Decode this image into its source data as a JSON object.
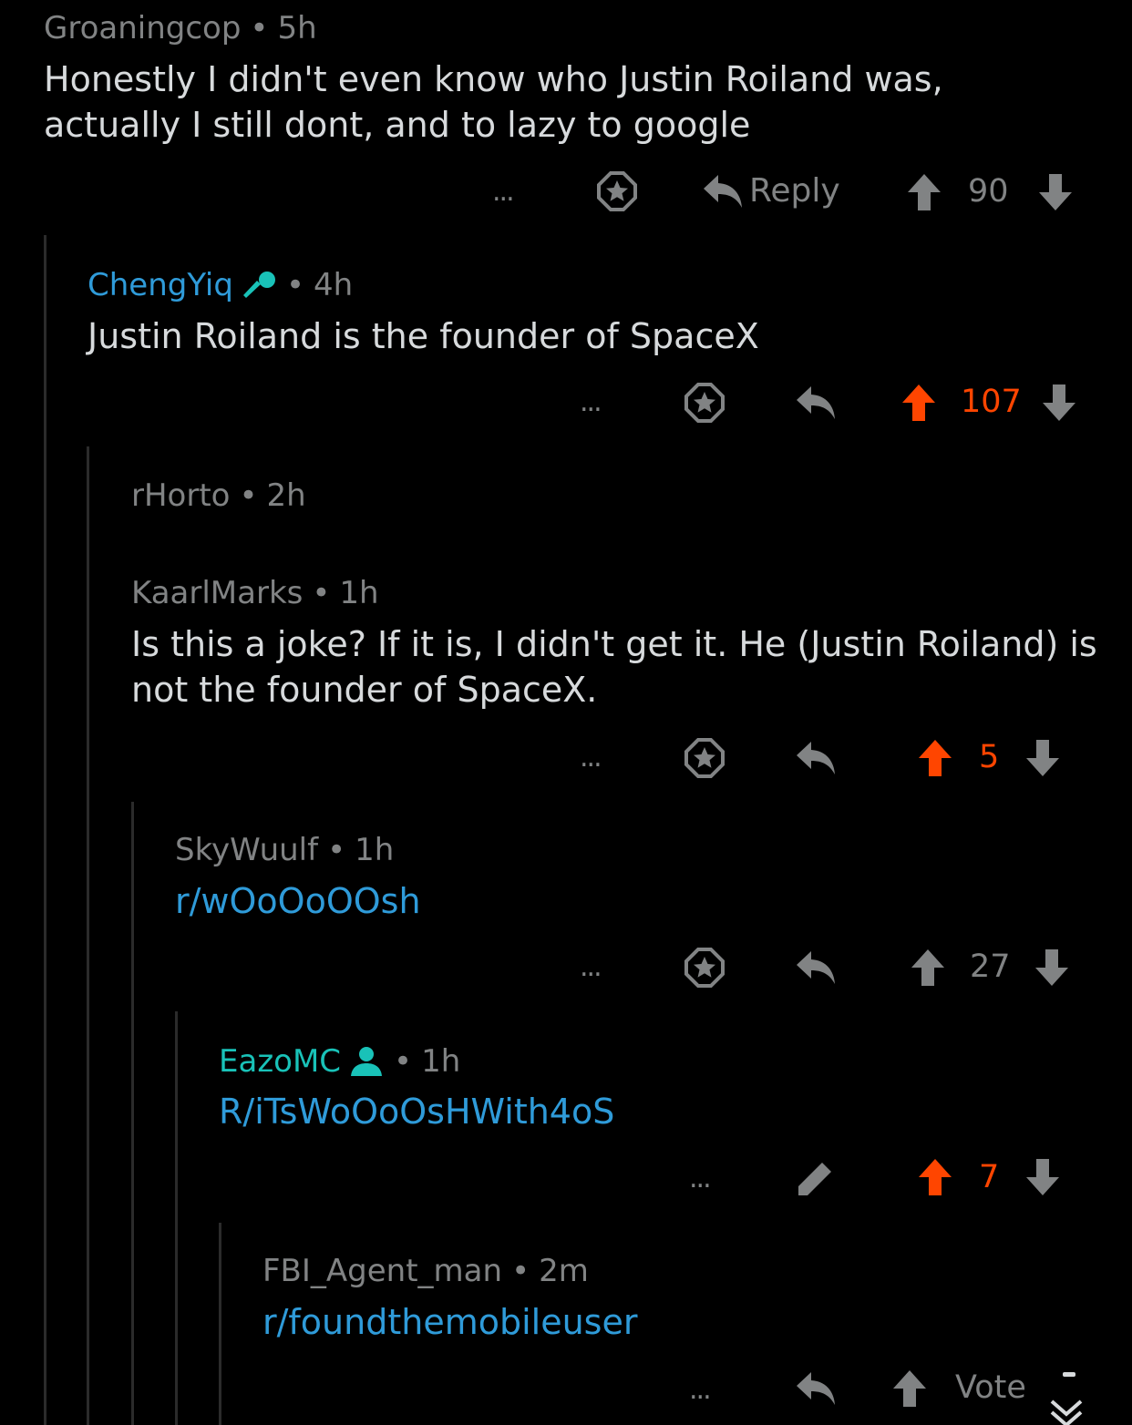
{
  "colors": {
    "background": "#000000",
    "text": "#d7dadc",
    "meta": "#818384",
    "upvoted": "#ff4500",
    "link": "#2f9bd9",
    "submitter": "#2f9bd9",
    "self": "#19c2b8"
  },
  "comments": [
    {
      "author": "Groaningcop",
      "age": "5h",
      "body": "Honestly I didn't even know who Justin Roiland was, actually I still dont, and to lazy to google",
      "actions": {
        "more": "...",
        "save_icon": "star-icon",
        "reply": "Reply",
        "score": "90",
        "vote_state": "none"
      }
    },
    {
      "author": "ChengYiq",
      "author_badge": "microphone-icon",
      "age": "4h",
      "body": "Justin Roiland is the founder of SpaceX",
      "actions": {
        "more": "...",
        "save_icon": "star-icon",
        "reply_icon": "reply-icon",
        "score": "107",
        "vote_state": "upvoted"
      }
    },
    {
      "author": "rHorto",
      "age": "2h",
      "body": ""
    },
    {
      "author": "KaarlMarks",
      "age": "1h",
      "body": "Is this a joke? If it is, I didn't get it. He (Justin Roiland) is not the founder of SpaceX.",
      "actions": {
        "more": "...",
        "save_icon": "star-icon",
        "reply_icon": "reply-icon",
        "score": "5",
        "vote_state": "upvoted"
      }
    },
    {
      "author": "SkyWuulf",
      "age": "1h",
      "body": "r/wOoOoOOsh",
      "actions": {
        "more": "...",
        "save_icon": "star-icon",
        "reply_icon": "reply-icon",
        "score": "27",
        "vote_state": "none"
      }
    },
    {
      "author": "EazoMC",
      "author_badge": "user-icon",
      "age": "1h",
      "body": "R/iTsWoOoOsHWith4oS",
      "actions": {
        "more": "...",
        "edit_icon": "pencil-icon",
        "score": "7",
        "vote_state": "upvoted"
      }
    },
    {
      "author": "FBI_Agent_man",
      "age": "2m",
      "body": "r/foundthemobileuser",
      "actions": {
        "more": "...",
        "reply_icon": "reply-icon",
        "vote_label": "Vote",
        "vote_state": "none"
      }
    }
  ],
  "separator": "•",
  "scroll_icon": "double-chevron-down-icon"
}
